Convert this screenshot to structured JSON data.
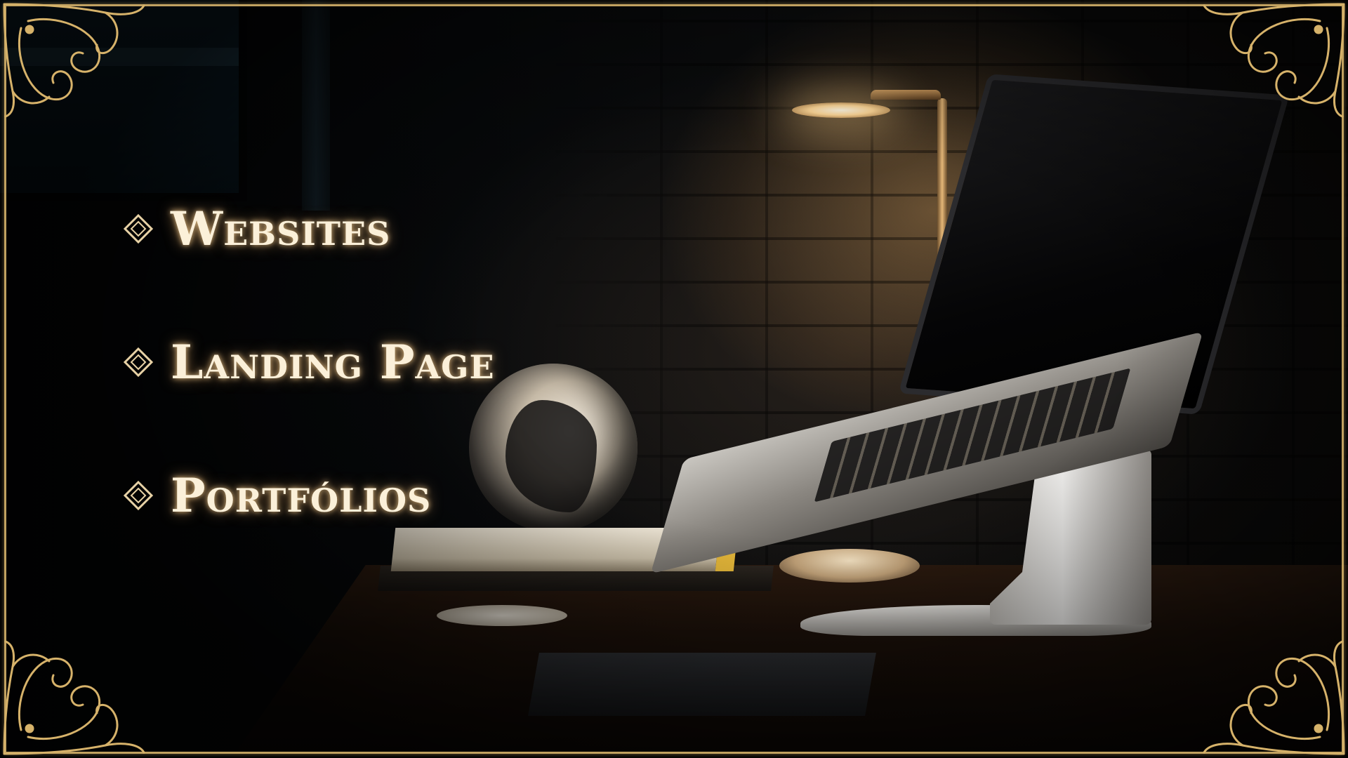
{
  "services": {
    "items": [
      {
        "label": "Websites"
      },
      {
        "label": "Landing Page"
      },
      {
        "label": "Portfólios"
      }
    ]
  },
  "theme": {
    "gold": "#d6b26a",
    "text_glow": "#fbf0d9",
    "background": "#050505"
  },
  "icons": {
    "bullet": "diamond-icon",
    "corner": "ornate-flourish-icon"
  }
}
